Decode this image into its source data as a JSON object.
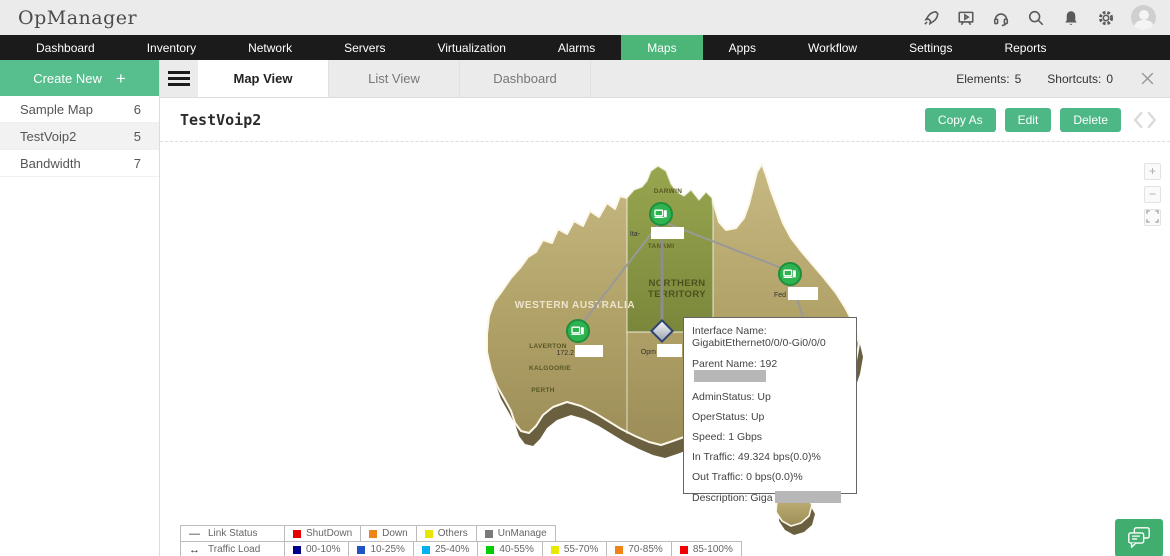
{
  "header": {
    "logo": "OpManager",
    "icons": [
      "rocket-icon",
      "presentation-icon",
      "headset-icon",
      "search-icon",
      "bell-icon",
      "gear-icon",
      "user-avatar"
    ]
  },
  "nav": {
    "items": [
      "Dashboard",
      "Inventory",
      "Network",
      "Servers",
      "Virtualization",
      "Alarms",
      "Maps",
      "Apps",
      "Workflow",
      "Settings",
      "Reports"
    ],
    "active": "Maps"
  },
  "sidebar": {
    "create_label": "Create New",
    "items": [
      {
        "label": "Sample Map",
        "count": 6,
        "active": false
      },
      {
        "label": "TestVoip2",
        "count": 5,
        "active": true
      },
      {
        "label": "Bandwidth",
        "count": 7,
        "active": false
      }
    ]
  },
  "tabs": {
    "items": [
      "Map View",
      "List View",
      "Dashboard"
    ],
    "active": "Map View",
    "elements_label": "Elements:",
    "elements_count": "5",
    "shortcuts_label": "Shortcuts:",
    "shortcuts_count": "0"
  },
  "title": {
    "text": "TestVoip2",
    "actions": {
      "copy_as": "Copy As",
      "edit": "Edit",
      "delete": "Delete"
    }
  },
  "icons": {
    "plus": "+",
    "zoom_in": "+",
    "zoom_out": "−"
  },
  "map": {
    "region_labels": {
      "wa": "WESTERN AUSTRALIA",
      "nt_line1": "NORTHERN",
      "nt_line2": "TERRITORY"
    },
    "cities": {
      "darwin": "DARWIN",
      "tanami": "TANAMI",
      "laverton": "LAVERTON",
      "kalgoorlie": "KALGOORIE",
      "perth": "PERTH"
    },
    "nodes": {
      "darwin_label": "Ita-",
      "fed_label": "Fed",
      "laverton_label": "172.2",
      "diamond_label": "Opm"
    },
    "colors": {
      "land": "#b4a568",
      "land_shadow": "#6a5f3e",
      "nt_green": "#87953f",
      "link": "#999999",
      "node_green": "#2fb351",
      "diamond_border": "#2e4372"
    }
  },
  "tooltip": {
    "rows": [
      {
        "text": "Interface Name: GigabitEthernet0/0/0-Gi0/0/0",
        "redacted": false
      },
      {
        "text": "Parent Name: 192",
        "redacted": true
      },
      {
        "text": "AdminStatus: Up",
        "redacted": false
      },
      {
        "text": "OperStatus: Up",
        "redacted": false
      },
      {
        "text": "Speed: 1 Gbps",
        "redacted": false
      },
      {
        "text": "In Traffic: 49.324 bps(0.0)%",
        "redacted": false
      },
      {
        "text": "Out Traffic: 0 bps(0.0)%",
        "redacted": false
      },
      {
        "text": "Description: Giga",
        "redacted": true
      }
    ]
  },
  "legend": {
    "rows": [
      {
        "label": "Link Status",
        "icon_glyph": "—",
        "items": [
          {
            "label": "ShutDown",
            "color": "#e60000"
          },
          {
            "label": "Down",
            "color": "#f08418"
          },
          {
            "label": "Others",
            "color": "#e6e600"
          },
          {
            "label": "UnManage",
            "color": "#7a7a7a"
          }
        ]
      },
      {
        "label": "Traffic Load",
        "icon_glyph": "↔",
        "items": [
          {
            "label": "00-10%",
            "color": "#00008c"
          },
          {
            "label": "10-25%",
            "color": "#2253c4"
          },
          {
            "label": "25-40%",
            "color": "#00b0f0"
          },
          {
            "label": "40-55%",
            "color": "#00cc00"
          },
          {
            "label": "55-70%",
            "color": "#e8e800"
          },
          {
            "label": "70-85%",
            "color": "#f08418"
          },
          {
            "label": "85-100%",
            "color": "#f00000"
          }
        ]
      }
    ]
  },
  "accent": {
    "button_green": "#4db885",
    "create_green": "#57be8d",
    "tab_green": "#4cb578",
    "chat_green": "#3fae6f"
  }
}
